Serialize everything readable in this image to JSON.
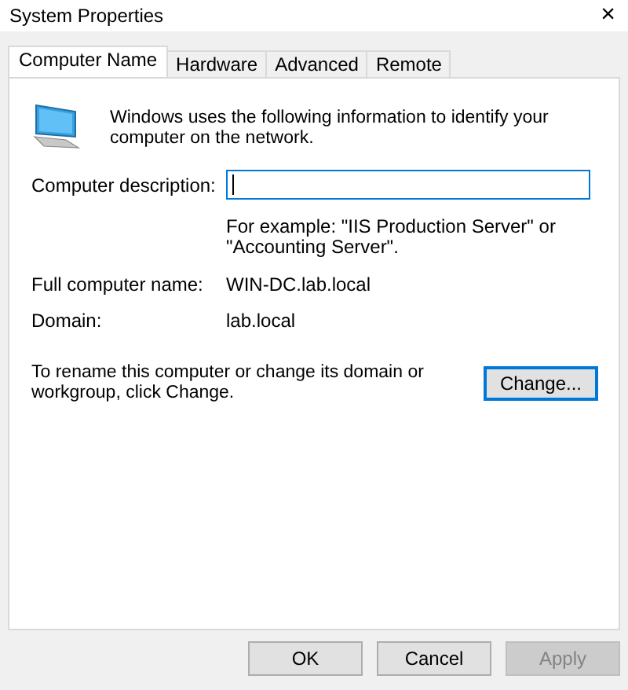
{
  "window": {
    "title": "System Properties",
    "close": "×"
  },
  "tabs": [
    {
      "label": "Computer Name",
      "selected": true
    },
    {
      "label": "Hardware",
      "selected": false
    },
    {
      "label": "Advanced",
      "selected": false
    },
    {
      "label": "Remote",
      "selected": false
    }
  ],
  "intro": "Windows uses the following information to identify your computer on the network.",
  "description": {
    "label": "Computer description:",
    "hint": "For example: \"IIS Production Server\" or \"Accounting Server\"."
  },
  "fields": [
    {
      "label": "Full computer name:",
      "value": "WIN-DC.lab.local"
    },
    {
      "label": "Domain:",
      "value": "lab.local"
    }
  ],
  "rename": {
    "text": "To rename this computer or change its domain or workgroup, click Change.",
    "button": "Change..."
  },
  "buttons": [
    {
      "label": "OK",
      "disabled": false
    },
    {
      "label": "Cancel",
      "disabled": false
    },
    {
      "label": "Apply",
      "disabled": true
    }
  ]
}
